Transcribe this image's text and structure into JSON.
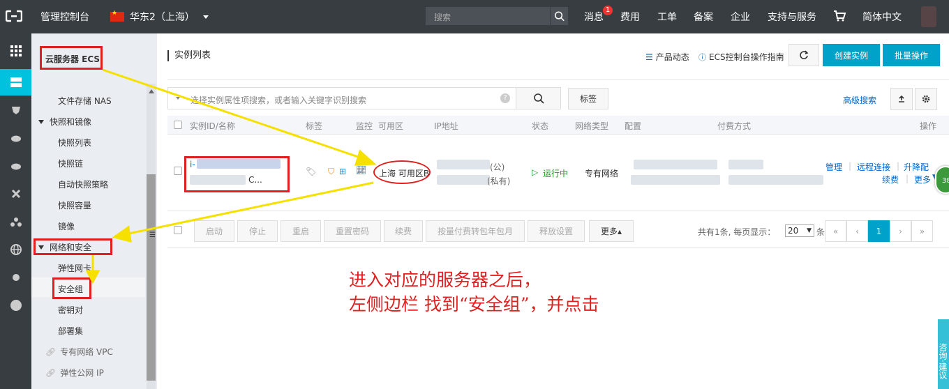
{
  "topbar": {
    "console_label": "管理控制台",
    "region_label": "华东2（上海）",
    "search_placeholder": "搜索",
    "nav": [
      {
        "label": "消息",
        "badge": "1"
      },
      {
        "label": "费用"
      },
      {
        "label": "工单"
      },
      {
        "label": "备案"
      },
      {
        "label": "企业"
      },
      {
        "label": "支持与服务"
      },
      {
        "label": "简体中文"
      }
    ]
  },
  "sidebar": {
    "product_title": "云服务器 ECS",
    "items": [
      {
        "label": "文件存储 NAS",
        "type": "item"
      },
      {
        "label": "快照和镜像",
        "type": "group"
      },
      {
        "label": "快照列表",
        "type": "item"
      },
      {
        "label": "快照链",
        "type": "item"
      },
      {
        "label": "自动快照策略",
        "type": "item"
      },
      {
        "label": "快照容量",
        "type": "item"
      },
      {
        "label": "镜像",
        "type": "item"
      },
      {
        "label": "网络和安全",
        "type": "group"
      },
      {
        "label": "弹性网卡",
        "type": "item"
      },
      {
        "label": "安全组",
        "type": "item"
      },
      {
        "label": "密钥对",
        "type": "item"
      },
      {
        "label": "部署集",
        "type": "item"
      },
      {
        "label": "专有网络 VPC",
        "type": "link"
      },
      {
        "label": "弹性公网 IP",
        "type": "link"
      }
    ]
  },
  "main": {
    "title": "实例列表",
    "product_news": "产品动态",
    "guide": "ECS控制台操作指南",
    "create_btn": "创建实例",
    "batch_btn": "批量操作",
    "search_placeholder": "选择实例属性项搜索，或者输入关键字识别搜索",
    "help_mark": "?",
    "tag_btn": "标签",
    "advanced_search": "高级搜索",
    "columns": [
      "实例ID/名称",
      "标签",
      "监控",
      "可用区",
      "IP地址",
      "状态",
      "网络类型",
      "配置",
      "付费方式",
      "操作"
    ],
    "row": {
      "id_prefix": "i-",
      "name_suffix": "C...",
      "zone": "上海 可用区B",
      "ip_public_suffix": "(公)",
      "ip_private_suffix": "(私有)",
      "status": "运行中",
      "network": "专有网络",
      "actions": [
        "管理",
        "远程连接",
        "升降配",
        "续费",
        "更多"
      ]
    },
    "footer_buttons": [
      "启动",
      "停止",
      "重启",
      "重置密码",
      "续费",
      "按量付费转包年包月",
      "释放设置",
      "更多▴"
    ],
    "pager_text_before": "共有1条, 每页显示：",
    "page_size": "20",
    "pager_text_after": "条",
    "pager": [
      "«",
      "‹",
      "1",
      "›",
      "»"
    ]
  },
  "annotation": {
    "line1": "进入对应的服务器之后，",
    "line2": "左侧边栏 找到“安全组”，并点击"
  },
  "floating": {
    "green_label": "38",
    "consult_label": "咨询·建议"
  },
  "colors": {
    "topbar": "#373d41",
    "accent": "#00a2ca",
    "annotation": "#e02020",
    "arrow": "#f5e000"
  }
}
